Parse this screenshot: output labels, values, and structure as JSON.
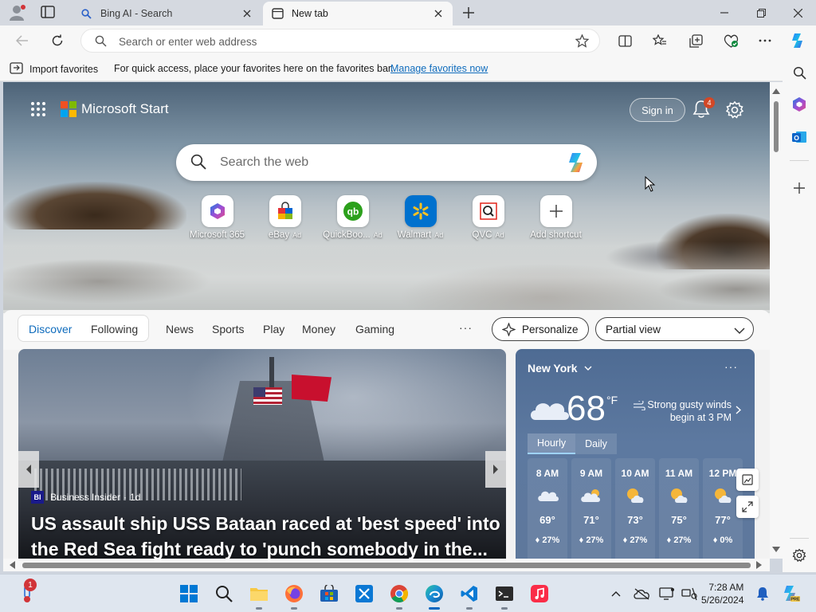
{
  "browser": {
    "tabs": [
      {
        "title": "Bing AI - Search",
        "active": false
      },
      {
        "title": "New tab",
        "active": true
      }
    ],
    "address_placeholder": "Search or enter web address",
    "favorites_bar": {
      "import_label": "Import favorites",
      "message": "For quick access, place your favorites here on the favorites bar.",
      "manage_link": "Manage favorites now"
    }
  },
  "newtab": {
    "brand": "Microsoft Start",
    "signin_label": "Sign in",
    "notification_count": "4",
    "search_placeholder": "Search the web",
    "shortcuts": [
      {
        "label": "Microsoft 365",
        "ad": ""
      },
      {
        "label": "eBay",
        "ad": "Ad"
      },
      {
        "label": "QuickBoo...",
        "ad": "Ad"
      },
      {
        "label": "Walmart",
        "ad": "Ad"
      },
      {
        "label": "QVC",
        "ad": "Ad"
      },
      {
        "label": "Add shortcut",
        "ad": ""
      }
    ],
    "feed_tabs": {
      "discover": "Discover",
      "following": "Following",
      "links": [
        "News",
        "Sports",
        "Play",
        "Money",
        "Gaming"
      ],
      "more": "···",
      "personalize": "Personalize",
      "view": "Partial view"
    },
    "top_story": {
      "source": "Business Insider",
      "source_badge": "BI",
      "age": "1d",
      "headline": "US assault ship USS Bataan raced at 'best speed' into the Red Sea fight ready to 'punch somebody in the..."
    },
    "weather": {
      "city": "New York",
      "temp": "68",
      "unit": "°F",
      "alert": "Strong gusty winds begin at 3 PM",
      "tabs": [
        "Hourly",
        "Daily"
      ],
      "more": "···",
      "hourly": [
        {
          "time": "8 AM",
          "temp": "69°",
          "precip": "27%",
          "icon": "cloudy-icon"
        },
        {
          "time": "9 AM",
          "temp": "71°",
          "precip": "27%",
          "icon": "partly-cloudy-icon"
        },
        {
          "time": "10 AM",
          "temp": "73°",
          "precip": "27%",
          "icon": "partly-sunny-icon"
        },
        {
          "time": "11 AM",
          "temp": "75°",
          "precip": "27%",
          "icon": "partly-sunny-icon"
        },
        {
          "time": "12 PM",
          "temp": "77°",
          "precip": "0%",
          "icon": "partly-sunny-icon"
        }
      ]
    }
  },
  "taskbar": {
    "time": "7:28 AM",
    "date": "5/26/2024",
    "notif_badge": "1"
  },
  "colors": {
    "accent": "#0f6cbd",
    "discover": "#0f6cbd",
    "weather_bg": "#5673a0"
  }
}
